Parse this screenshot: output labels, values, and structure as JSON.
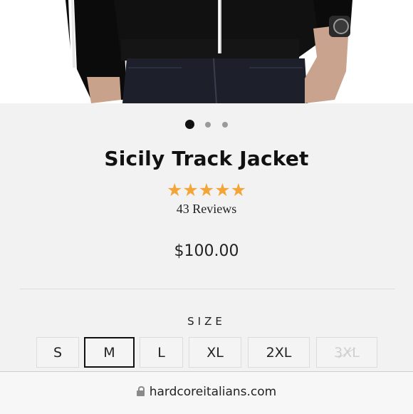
{
  "product": {
    "title": "Sicily Track Jacket",
    "rating_stars": "★★★★★",
    "rating_value": 5,
    "reviews_label": "43 Reviews",
    "price": "$100.00"
  },
  "carousel": {
    "image_count": 3,
    "active_index": 0
  },
  "size_selector": {
    "label": "SIZE",
    "options": [
      {
        "label": "S",
        "state": "available"
      },
      {
        "label": "M",
        "state": "selected"
      },
      {
        "label": "L",
        "state": "available"
      },
      {
        "label": "XL",
        "state": "available"
      },
      {
        "label": "2XL",
        "state": "available"
      },
      {
        "label": "3XL",
        "state": "unavailable"
      }
    ]
  },
  "browser": {
    "url": "hardcoreitalians.com",
    "lock_icon": "lock-icon"
  },
  "colors": {
    "star": "#f2a63a",
    "background": "#f2f2f2",
    "selected_border": "#111111"
  }
}
